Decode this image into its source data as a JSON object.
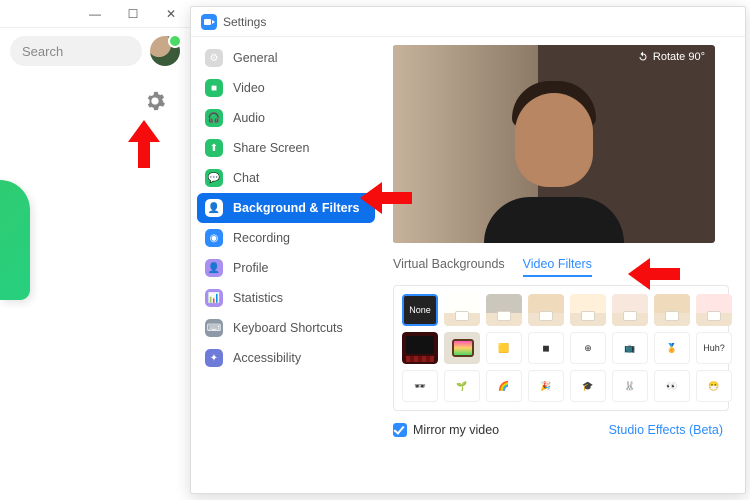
{
  "window": {
    "search_placeholder": "Search"
  },
  "settings": {
    "title": "Settings",
    "nav": [
      {
        "label": "General",
        "color": "#d9d9d9",
        "glyph": "⚙"
      },
      {
        "label": "Video",
        "color": "#27c26c",
        "glyph": "■"
      },
      {
        "label": "Audio",
        "color": "#27c26c",
        "glyph": "🎧"
      },
      {
        "label": "Share Screen",
        "color": "#27c26c",
        "glyph": "⬆"
      },
      {
        "label": "Chat",
        "color": "#27c26c",
        "glyph": "💬"
      },
      {
        "label": "Background & Filters",
        "color": "#0e71eb",
        "glyph": "👤",
        "active": true
      },
      {
        "label": "Recording",
        "color": "#2d8cff",
        "glyph": "◉"
      },
      {
        "label": "Profile",
        "color": "#a98ff0",
        "glyph": "👤"
      },
      {
        "label": "Statistics",
        "color": "#a98ff0",
        "glyph": "📊"
      },
      {
        "label": "Keyboard Shortcuts",
        "color": "#8d99a6",
        "glyph": "⌨"
      },
      {
        "label": "Accessibility",
        "color": "#6e7bd9",
        "glyph": "✦"
      }
    ],
    "rotate_label": "Rotate 90°",
    "tabs": {
      "virtual": "Virtual Backgrounds",
      "filters": "Video Filters",
      "active": "filters"
    },
    "filters": {
      "none_label": "None",
      "row1_tints": [
        "#ffffff",
        "#bfbfbf",
        "#e4d1b8",
        "#f4e6d9",
        "#e9dde0",
        "#e4d1b8",
        "#ffd9e6"
      ],
      "row2": [
        "theater",
        "tv",
        "emoji:🟨",
        "emoji:◼︎",
        "emoji:⊕",
        "emoji:📺",
        "emoji:🏅",
        "emoji:Huh?"
      ],
      "row3": [
        "emoji:🕶",
        "emoji:🌱",
        "emoji:🌈",
        "emoji:🎉",
        "emoji:🎓",
        "emoji:🐰",
        "emoji:👀",
        "emoji:😷"
      ]
    },
    "mirror_label": "Mirror my video",
    "studio_label": "Studio Effects (Beta)"
  }
}
